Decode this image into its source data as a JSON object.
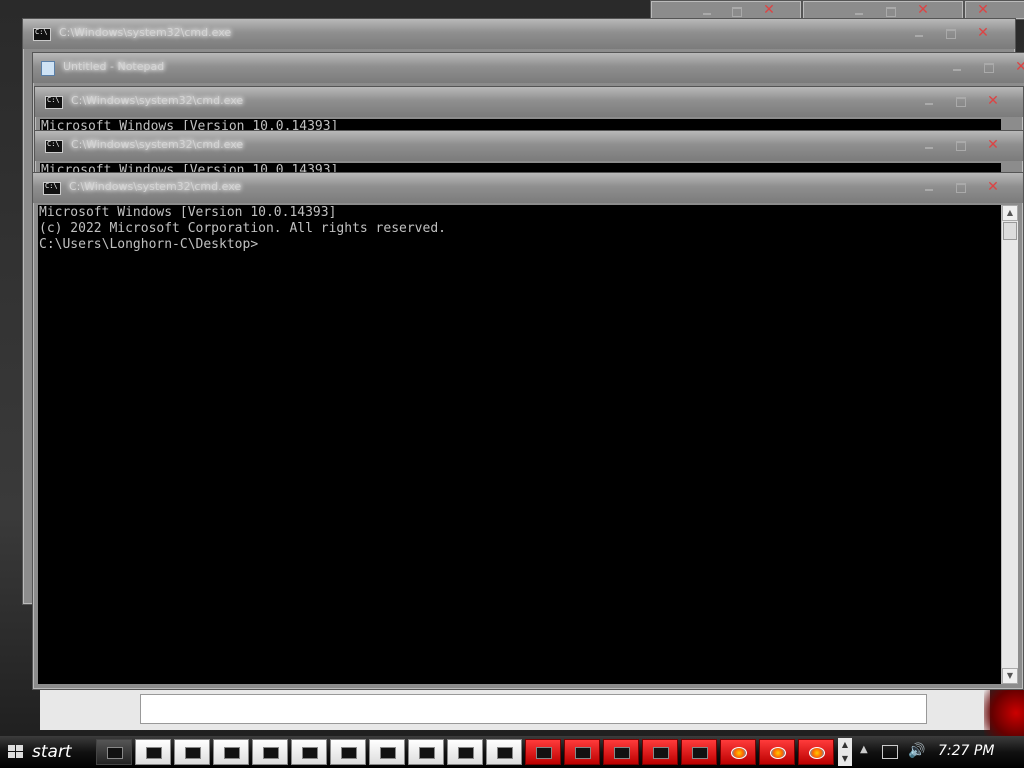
{
  "windows": [
    {
      "title": "C:\\Windows\\system32\\cmd.exe",
      "lines": []
    },
    {
      "title": "Untitled - Notepad",
      "lines": []
    },
    {
      "title": "C:\\Windows\\system32\\cmd.exe",
      "lines": [
        "Microsoft Windows [Version 10.0.14393]"
      ]
    },
    {
      "title": "C:\\Windows\\system32\\cmd.exe",
      "lines": [
        "Microsoft Windows [Version 10.0.14393]"
      ]
    },
    {
      "title": "C:\\Windows\\system32\\cmd.exe",
      "lines": [
        "Microsoft Windows [Version 10.0.14393]",
        "(c) 2022 Microsoft Corporation. All rights reserved.",
        "",
        "C:\\Users\\Longhorn-C\\Desktop>"
      ]
    }
  ],
  "taskbar": {
    "start_label": "start",
    "clock": "7:27 PM",
    "buttons": [
      {
        "icon": "cmd-icon",
        "style": "dark"
      },
      {
        "icon": "cmd-icon",
        "style": "white"
      },
      {
        "icon": "cmd-icon",
        "style": "white"
      },
      {
        "icon": "cmd-icon",
        "style": "white"
      },
      {
        "icon": "cmd-icon",
        "style": "white"
      },
      {
        "icon": "cmd-icon",
        "style": "white"
      },
      {
        "icon": "cmd-icon",
        "style": "white"
      },
      {
        "icon": "cmd-icon",
        "style": "white"
      },
      {
        "icon": "cmd-icon",
        "style": "white"
      },
      {
        "icon": "cmd-icon",
        "style": "white"
      },
      {
        "icon": "cmd-icon",
        "style": "white"
      },
      {
        "icon": "cmd-icon",
        "style": "red"
      },
      {
        "icon": "cmd-icon",
        "style": "red"
      },
      {
        "icon": "cmd-icon",
        "style": "red"
      },
      {
        "icon": "cmd-icon",
        "style": "red"
      },
      {
        "icon": "cmd-icon",
        "style": "red"
      },
      {
        "icon": "paint-icon",
        "style": "red"
      },
      {
        "icon": "paint-icon",
        "style": "red"
      },
      {
        "icon": "paint-icon",
        "style": "red"
      }
    ]
  },
  "colors": {
    "console_bg": "#000000",
    "console_text": "#c0c0c0",
    "close": "#dd4444",
    "taskbar_red": "#ee2222"
  }
}
